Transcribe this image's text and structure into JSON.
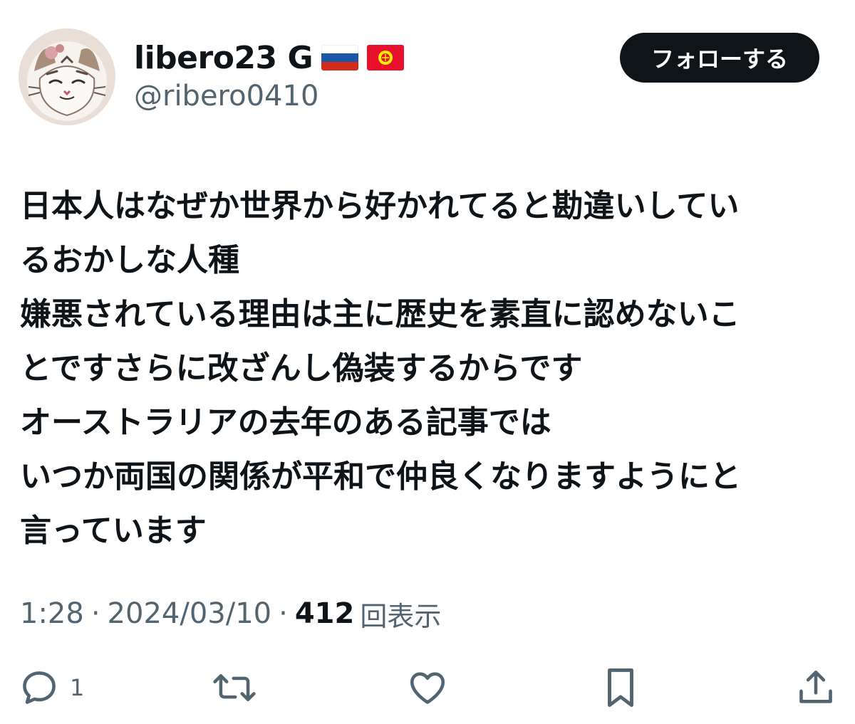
{
  "user": {
    "display_name": "libero23 G",
    "handle": "@ribero0410",
    "avatar_icon": "cat-avatar-icon",
    "flags": [
      "russia-flag-icon",
      "kyrgyzstan-flag-icon"
    ]
  },
  "follow_button": {
    "label": "フォローする"
  },
  "tweet": {
    "lines": [
      "日本人はなぜか世界から好かれてると勘違いしてい",
      "るおかしな人種",
      "嫌悪されている理由は主に歴史を素直に認めないこ",
      "とですさらに改ざんし偽装するからです",
      "オーストラリアの去年のある記事では",
      "いつか両国の関係が平和で仲良くなりますようにと",
      "言っています"
    ]
  },
  "meta": {
    "time": "1:28",
    "separator": "·",
    "date": "2024/03/10",
    "views_count": "412",
    "views_label": "回表示"
  },
  "actions": {
    "reply_count": "1",
    "icons": [
      "reply-icon",
      "retweet-icon",
      "like-icon",
      "bookmark-icon",
      "share-icon"
    ]
  },
  "colors": {
    "text_primary": "#0f1419",
    "text_secondary": "#536471",
    "button_bg": "#0f1419",
    "button_text": "#ffffff",
    "background": "#ffffff"
  }
}
